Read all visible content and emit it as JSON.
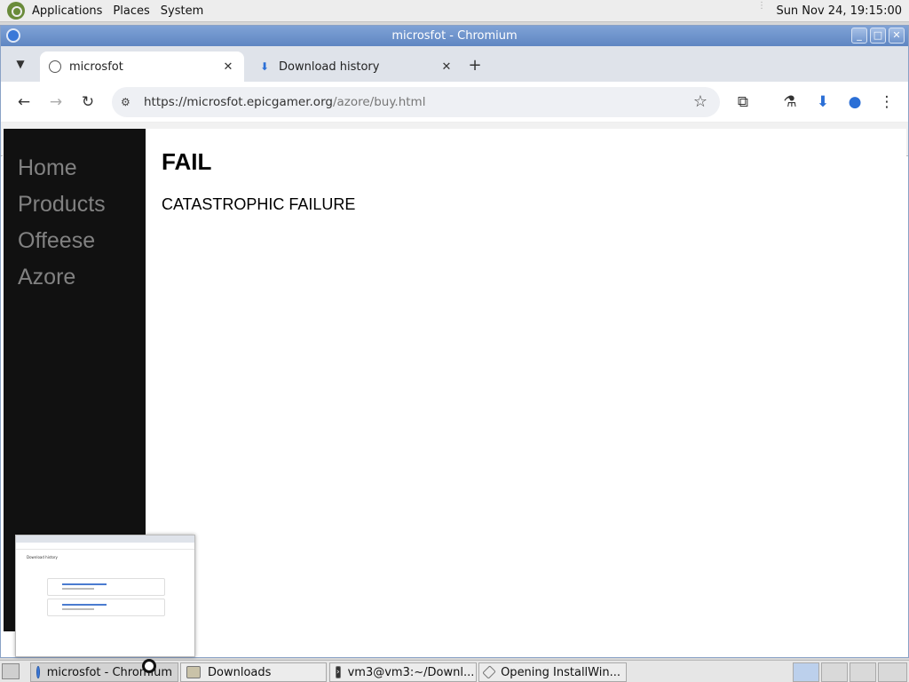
{
  "top_panel": {
    "menus": [
      "Applications",
      "Places",
      "System"
    ],
    "clock": "Sun Nov 24, 19:15:00"
  },
  "window": {
    "title": "microsfot - Chromium"
  },
  "tabs": [
    {
      "title": "microsfot",
      "icon": "globe-icon",
      "active": true
    },
    {
      "title": "Download history",
      "icon": "download-icon",
      "active": false
    }
  ],
  "toolbar": {
    "url_host": "https://microsfot.epicgamer.org",
    "url_path": "/azore/buy.html"
  },
  "page": {
    "nav": [
      "Home",
      "Products",
      "Offeese",
      "Azore"
    ],
    "heading": "FAIL",
    "message": "CATASTROPHIC FAILURE"
  },
  "preview": {
    "title": "Download history"
  },
  "taskbar": {
    "tasks": [
      {
        "label": "microsfot - Chromium",
        "icon": "chromium-icon"
      },
      {
        "label": "Downloads",
        "icon": "folder-icon"
      },
      {
        "label": "vm3@vm3:~/Downl...",
        "icon": "terminal-icon"
      },
      {
        "label": "Opening InstallWin...",
        "icon": "dialog-icon"
      }
    ]
  }
}
